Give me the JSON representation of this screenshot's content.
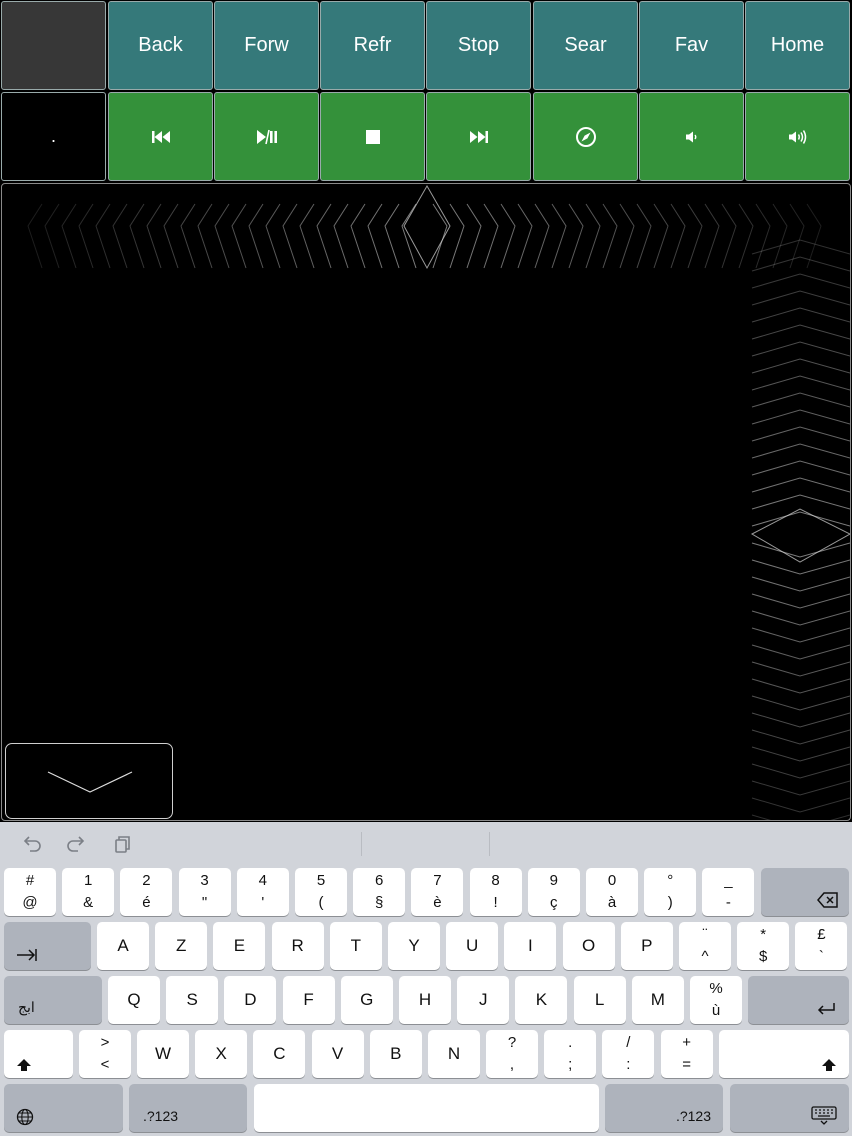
{
  "nav_buttons": [
    "Back",
    "Forw",
    "Refr",
    "Stop",
    "Sear",
    "Fav",
    "Home"
  ],
  "dot_label": ".",
  "media_icons": [
    "previous-track-icon",
    "play-pause-icon",
    "stop-icon",
    "next-track-icon",
    "compass-icon",
    "volume-down-icon",
    "volume-up-icon"
  ],
  "colors": {
    "nav": "#35797a",
    "media": "#34913a",
    "keyboard": "#d1d4da"
  },
  "keyboard": {
    "row1": [
      {
        "top": "#",
        "bot": "@"
      },
      {
        "top": "1",
        "bot": "&"
      },
      {
        "top": "2",
        "bot": "é"
      },
      {
        "top": "3",
        "bot": "\""
      },
      {
        "top": "4",
        "bot": "'"
      },
      {
        "top": "5",
        "bot": "("
      },
      {
        "top": "6",
        "bot": "§"
      },
      {
        "top": "7",
        "bot": "è"
      },
      {
        "top": "8",
        "bot": "!"
      },
      {
        "top": "9",
        "bot": "ç"
      },
      {
        "top": "0",
        "bot": "à"
      },
      {
        "top": "°",
        "bot": ")"
      },
      {
        "top": "_",
        "bot": "-"
      }
    ],
    "row2": [
      "A",
      "Z",
      "E",
      "R",
      "T",
      "Y",
      "U",
      "I",
      "O",
      "P"
    ],
    "row2_extra": [
      {
        "top": "¨",
        "bot": "^"
      },
      {
        "top": "*",
        "bot": "$"
      },
      {
        "top": "£",
        "bot": "`"
      }
    ],
    "row3": [
      "Q",
      "S",
      "D",
      "F",
      "G",
      "H",
      "J",
      "K",
      "L",
      "M"
    ],
    "row3_extra": {
      "top": "%",
      "bot": "ù"
    },
    "row4_first": {
      "top": ">",
      "bot": "<"
    },
    "row4": [
      "W",
      "X",
      "C",
      "V",
      "B",
      "N"
    ],
    "row4_extra": [
      {
        "top": "?",
        "bot": ","
      },
      {
        "top": ".",
        "bot": ";"
      },
      {
        "top": "/",
        "bot": ":"
      },
      {
        "top": "+",
        "bot": "="
      }
    ],
    "arabic_label": "ابج",
    "num_label": ".?123"
  }
}
